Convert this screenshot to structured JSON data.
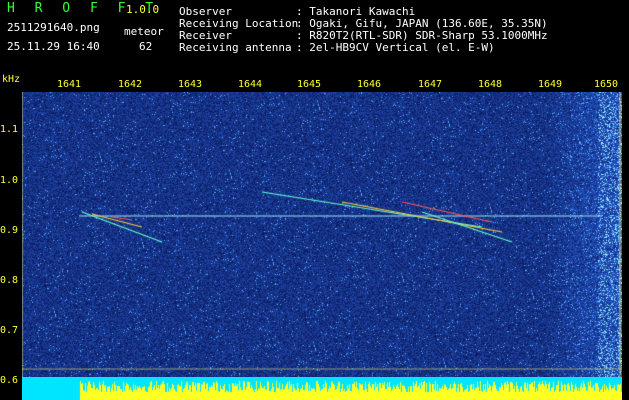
{
  "header": {
    "logo": "H R O F F T",
    "version": "1.0.0",
    "filename": "2511291640.png",
    "detection_label": "meteor",
    "datetime": "25.11.29 16:40",
    "detection_count": "62",
    "fields": [
      {
        "label": "Observer",
        "value": ": Takanori Kawachi"
      },
      {
        "label": "Receiving Location",
        "value": ": Ogaki, Gifu, JAPAN (136.60E, 35.35N)"
      },
      {
        "label": "Receiver",
        "value": ": R820T2(RTL-SDR) SDR-Sharp 53.1000MHz"
      },
      {
        "label": "Receiving antenna",
        "value": ": 2el-HB9CV Vertical (el. E-W)"
      }
    ]
  },
  "axis": {
    "unit": "kHz",
    "y_ticks": [
      "1.1",
      "1.0",
      "0.9",
      "0.8",
      "0.7",
      "0.6"
    ],
    "x_ticks": [
      "1641",
      "1642",
      "1643",
      "1644",
      "1645",
      "1646",
      "1647",
      "1648",
      "1649",
      "1650"
    ]
  },
  "colors": {
    "background": "#000000",
    "label_yellow": "#ffff33",
    "logo_green": "#33ff33",
    "spectrum_base": "#0a1f6b"
  }
}
